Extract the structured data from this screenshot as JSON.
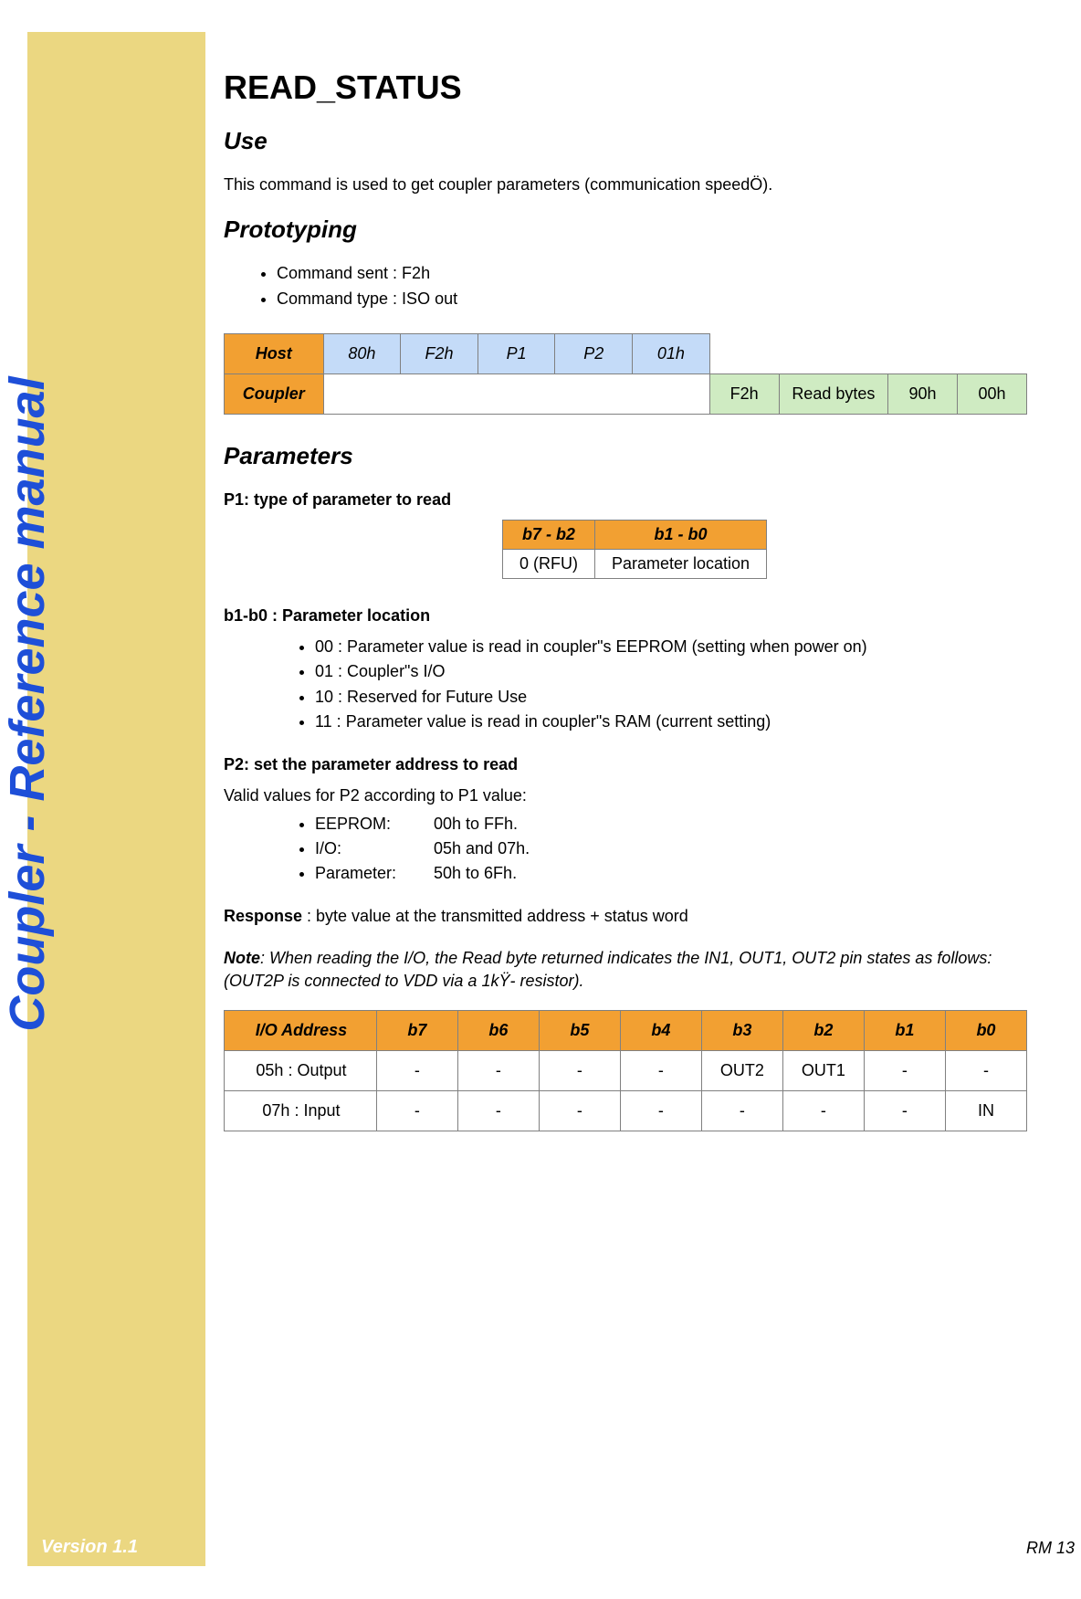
{
  "sidebar": {
    "title": "Coupler - Reference manual",
    "version": "Version 1.1",
    "pageNumber": "RM 13"
  },
  "command": {
    "title": "READ_STATUS"
  },
  "sections": {
    "useHeading": "Use",
    "useText": "This command is used to get coupler parameters (communication speedÖ).",
    "protoHeading": "Prototyping",
    "protoBullets": {
      "b0": "Command sent : F2h",
      "b1": "Command type : ISO out"
    },
    "paramsHeading": "Parameters",
    "p1Heading": "P1: type of parameter to read",
    "b1b0Heading": "b1-b0 : Parameter location",
    "b1b0": {
      "i0": "00 : Parameter value is read in coupler\"s EEPROM (setting when power on)",
      "i1": "01 : Coupler\"s I/O",
      "i2": "10 : Reserved for Future Use",
      "i3": "11 : Parameter value is read in coupler\"s RAM (current setting)"
    },
    "p2Heading": "P2: set the parameter address to read",
    "p2Intro": "Valid values for P2 according to P1 value:",
    "p2rows": {
      "r0l": "EEPROM:",
      "r0v": "00h to FFh.",
      "r1l": "I/O:",
      "r1v": "05h and 07h.",
      "r2l": "Parameter:",
      "r2v": "50h to 6Fh."
    },
    "responseLabel": "Response",
    "responseText": " : byte value at the transmitted address + status word",
    "noteLabel": "Note",
    "noteText": ":  When reading the I/O, the Read byte returned indicates the IN1, OUT1, OUT2 pin states as follows: (OUT2P is connected to VDD via a 1kŸ- resistor)."
  },
  "protoTable": {
    "hostLabel": "Host",
    "couplerLabel": "Coupler",
    "h": {
      "c0": "80h",
      "c1": "F2h",
      "c2": "P1",
      "c3": "P2",
      "c4": "01h"
    },
    "c": {
      "c0": "F2h",
      "c1": "Read bytes",
      "c2": "90h",
      "c3": "00h"
    }
  },
  "p1Table": {
    "h0": "b7 - b2",
    "h1": "b1 - b0",
    "r0": "0 (RFU)",
    "r1": "Parameter location"
  },
  "ioTable": {
    "hAddr": "I/O Address",
    "b7": "b7",
    "b6": "b6",
    "b5": "b5",
    "b4": "b4",
    "b3": "b3",
    "b2": "b2",
    "b1": "b1",
    "b0": "b0",
    "r0addr": "05h : Output",
    "r0": {
      "c7": "-",
      "c6": "-",
      "c5": "-",
      "c4": "-",
      "c3": "OUT2",
      "c2": "OUT1",
      "c1": "-",
      "c0": "-"
    },
    "r1addr": "07h : Input",
    "r1": {
      "c7": "-",
      "c6": "-",
      "c5": "-",
      "c4": "-",
      "c3": "-",
      "c2": "-",
      "c1": "-",
      "c0": "IN"
    }
  }
}
